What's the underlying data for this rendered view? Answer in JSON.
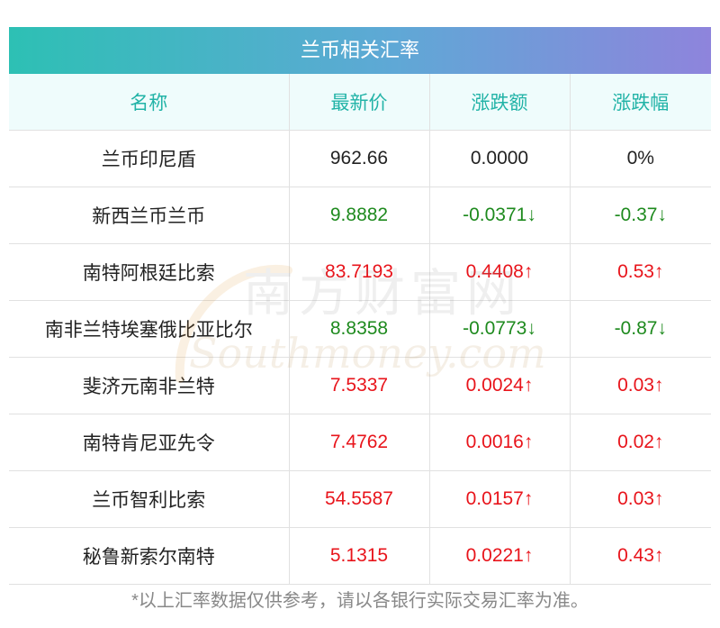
{
  "title": "兰币相关汇率",
  "headers": [
    "名称",
    "最新价",
    "涨跌额",
    "涨跌幅"
  ],
  "rows": [
    {
      "name": "兰币印尼盾",
      "price": "962.66",
      "change": "0.0000",
      "pct": "0%",
      "dir": "flat"
    },
    {
      "name": "新西兰币兰币",
      "price": "9.8882",
      "change": "-0.0371↓",
      "pct": "-0.37↓",
      "dir": "down"
    },
    {
      "name": "南特阿根廷比索",
      "price": "83.7193",
      "change": "0.4408↑",
      "pct": "0.53↑",
      "dir": "up"
    },
    {
      "name": "南非兰特埃塞俄比亚比尔",
      "price": "8.8358",
      "change": "-0.0773↓",
      "pct": "-0.87↓",
      "dir": "down"
    },
    {
      "name": "斐济元南非兰特",
      "price": "7.5337",
      "change": "0.0024↑",
      "pct": "0.03↑",
      "dir": "up"
    },
    {
      "name": "南特肯尼亚先令",
      "price": "7.4762",
      "change": "0.0016↑",
      "pct": "0.02↑",
      "dir": "up"
    },
    {
      "name": "兰币智利比索",
      "price": "54.5587",
      "change": "0.0157↑",
      "pct": "0.03↑",
      "dir": "up"
    },
    {
      "name": "秘鲁新索尔南特",
      "price": "5.1315",
      "change": "0.0221↑",
      "pct": "0.43↑",
      "dir": "up"
    }
  ],
  "footnote": "*以上汇率数据仅供参考，请以各银行实际交易汇率为准。",
  "watermark": {
    "cn": "南方财富网",
    "en": "Southmoney.com"
  },
  "colors": {
    "up": "#e8141b",
    "down": "#1e8a1e",
    "flat": "#222222",
    "header_text": "#22b3a7",
    "header_bg": "#effcfc"
  },
  "chart_data": {
    "type": "table",
    "title": "兰币相关汇率",
    "columns": [
      "名称",
      "最新价",
      "涨跌额",
      "涨跌幅"
    ],
    "rows": [
      [
        "兰币印尼盾",
        "962.66",
        "0.0000",
        "0%"
      ],
      [
        "新西兰币兰币",
        "9.8882",
        "-0.0371↓",
        "-0.37↓"
      ],
      [
        "南特阿根廷比索",
        "83.7193",
        "0.4408↑",
        "0.53↑"
      ],
      [
        "南非兰特埃塞俄比亚比尔",
        "8.8358",
        "-0.0773↓",
        "-0.87↓"
      ],
      [
        "斐济元南非兰特",
        "7.5337",
        "0.0024↑",
        "0.03↑"
      ],
      [
        "南特肯尼亚先令",
        "7.4762",
        "0.0016↑",
        "0.02↑"
      ],
      [
        "兰币智利比索",
        "54.5587",
        "0.0157↑",
        "0.03↑"
      ],
      [
        "秘鲁新索尔南特",
        "5.1315",
        "0.0221↑",
        "0.43↑"
      ]
    ]
  }
}
